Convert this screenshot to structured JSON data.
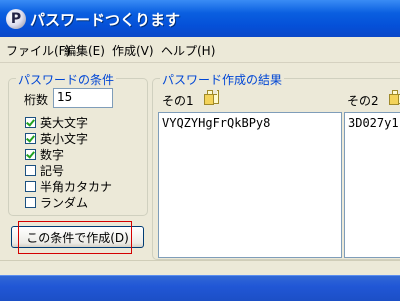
{
  "window": {
    "icon_glyph": "P",
    "title": "パスワードつくります"
  },
  "menu": [
    {
      "label": "ファイル(F)"
    },
    {
      "label": "編集(E)"
    },
    {
      "label": "作成(V)"
    },
    {
      "label": "ヘルプ(H)"
    }
  ],
  "conditions": {
    "title": "パスワードの条件",
    "digits_label": "桁数",
    "digits_value": "15",
    "options": [
      {
        "label": "英大文字",
        "checked": true
      },
      {
        "label": "英小文字",
        "checked": true
      },
      {
        "label": "数字",
        "checked": true
      },
      {
        "label": "記号",
        "checked": false
      },
      {
        "label": "半角カタカナ",
        "checked": false
      },
      {
        "label": "ランダム",
        "checked": false
      }
    ],
    "create_button": "この条件で作成(D)"
  },
  "results": {
    "title": "パスワード作成の結果",
    "columns": [
      {
        "label": "その1",
        "value": "VYQZYHgFrQkBPy8",
        "icon": "copy-icon"
      },
      {
        "label": "その2",
        "value": "3D027y1",
        "icon": "copy-icon"
      }
    ]
  },
  "colors": {
    "titlebar": "#0a5fe0",
    "group_title": "#0046d5",
    "highlight_frame": "#d40000",
    "taskbar": "#2157d6"
  }
}
